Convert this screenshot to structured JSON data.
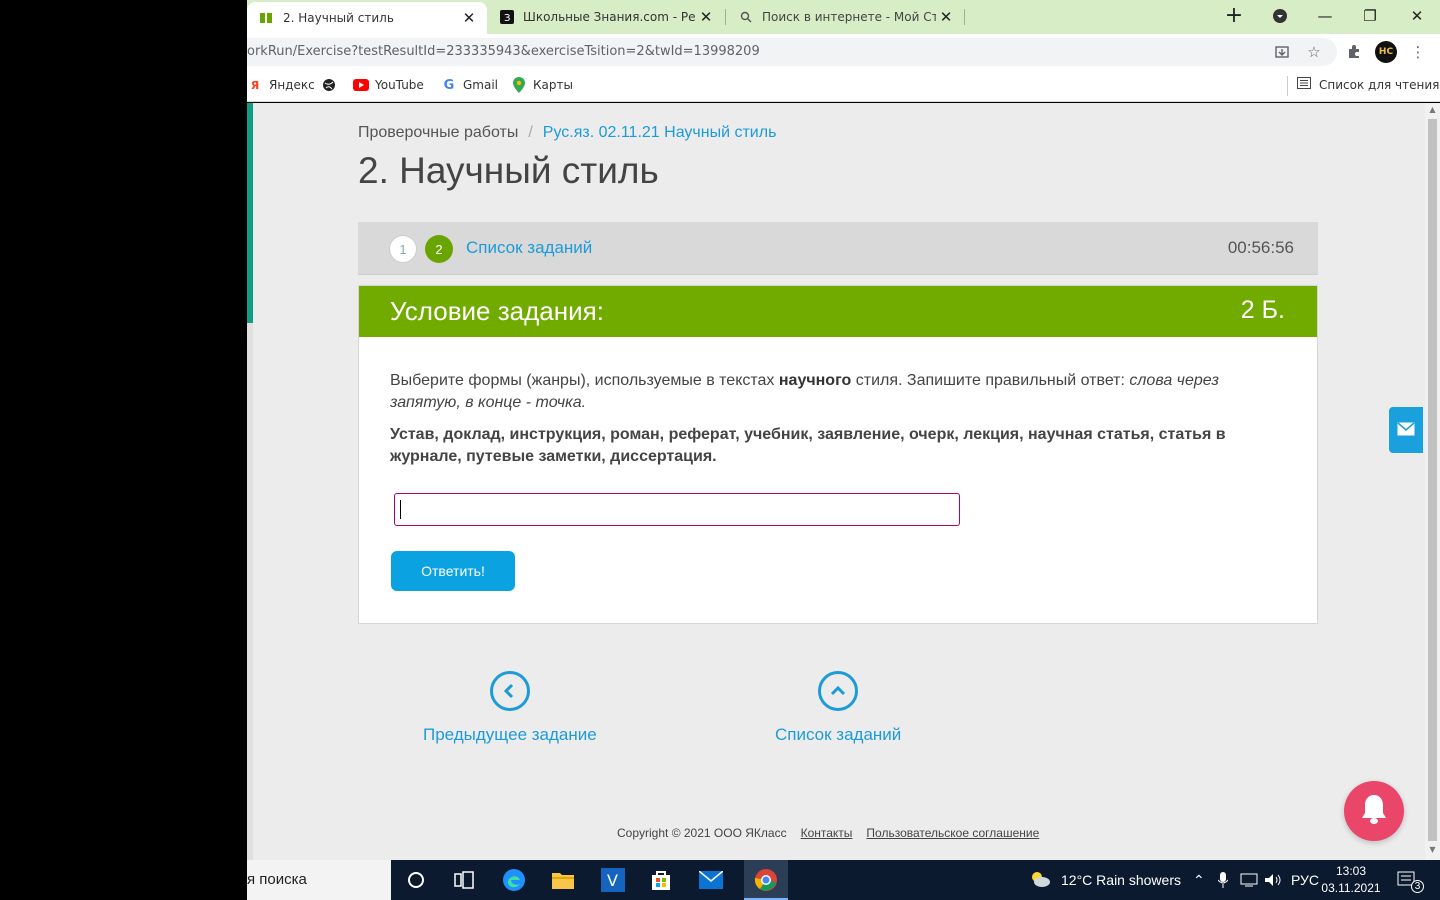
{
  "browser": {
    "tabs": [
      {
        "title": "2. Научный стиль",
        "favicon": "yaklass-icon",
        "active": true
      },
      {
        "title": "Школьные Знания.com - Решае",
        "favicon": "znania-icon",
        "active": false
      },
      {
        "title": "Поиск в интернете - Мой Старт",
        "favicon": "search-icon",
        "active": false
      }
    ],
    "url": "orkRun/Exercise?testResultId=233335943&exerciseTsition=2&twId=13998209",
    "bookmarks": [
      {
        "label": "Яндекс",
        "icon": "yandex-icon"
      },
      {
        "label": "",
        "icon": "globe-icon"
      },
      {
        "label": "YouTube",
        "icon": "youtube-icon"
      },
      {
        "label": "Gmail",
        "icon": "google-icon"
      },
      {
        "label": "Карты",
        "icon": "maps-icon"
      }
    ],
    "reading_list": "Список для чтения",
    "profile_initials": "HC"
  },
  "page": {
    "breadcrumb": {
      "root": "Проверочные работы",
      "separator": "/",
      "current": "Рус.яз. 02.11.21 Научный стиль"
    },
    "title": "2. Научный стиль",
    "progress": {
      "steps": [
        "1",
        "2"
      ],
      "tasks_link": "Список заданий",
      "timer": "00:56:56"
    },
    "task": {
      "header": "Условие задания:",
      "points": "2 Б.",
      "instruction_pre": "Выберите формы (жанры), используемые в текстах ",
      "instruction_bold": "научного",
      "instruction_mid": " стиля. Запишите правильный ответ: ",
      "instruction_italic": "слова через запятую, в конце - точка.",
      "words": "Устав, доклад, инструкция, роман, реферат, учебник, заявление, очерк, лекция, научная статья, статья в журнале, путевые заметки, диссертация.",
      "answer_value": "",
      "submit_label": "Ответить!"
    },
    "nav": {
      "prev_label": "Предыдущее задание",
      "list_label": "Список заданий"
    },
    "footer": {
      "copyright": "Copyright © 2021 ООО ЯКласс",
      "contacts": "Контакты",
      "agreement": "Пользовательское соглашение"
    }
  },
  "taskbar": {
    "search_text": "я поиска",
    "weather": "12°C  Rain showers",
    "language": "РУС",
    "time": "13:03",
    "date": "03.11.2021",
    "notifications": "3"
  },
  "colors": {
    "accent_green": "#72ab00",
    "link_blue": "#1d9bd8",
    "button_blue": "#0aa2e0",
    "bell_pink": "#e9466a",
    "tabstrip": "#d6edc5"
  }
}
